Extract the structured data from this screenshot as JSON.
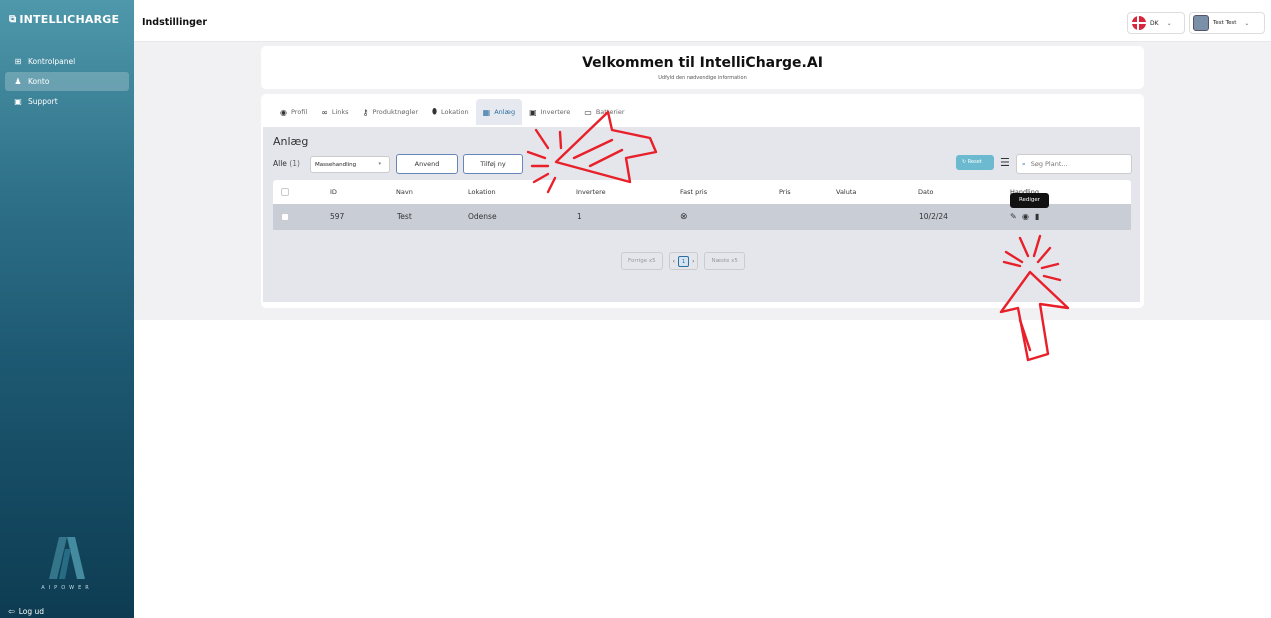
{
  "sidebar": {
    "brand": "INTELLICHARGE",
    "items": [
      {
        "label": "Kontrolpanel",
        "icon": "grid-icon"
      },
      {
        "label": "Konto",
        "icon": "users-icon"
      },
      {
        "label": "Support",
        "icon": "support-icon"
      }
    ],
    "active_index": 1,
    "logo_text": "AIPOWER",
    "logout": "Log ud"
  },
  "header": {
    "title": "Indstillinger",
    "language": "DK",
    "user": "Test Test"
  },
  "welcome": {
    "title": "Velkommen til IntelliCharge.AI",
    "subtitle": "Udfyld den nødvendige information"
  },
  "tabs": [
    {
      "label": "Profil",
      "icon": "user-circle-icon"
    },
    {
      "label": "Links",
      "icon": "link-icon"
    },
    {
      "label": "Produktnøgler",
      "icon": "key-icon"
    },
    {
      "label": "Lokation",
      "icon": "location-pin-icon"
    },
    {
      "label": "Anlæg",
      "icon": "dashboard-icon"
    },
    {
      "label": "Invertere",
      "icon": "chip-icon"
    },
    {
      "label": "Batterier",
      "icon": "battery-icon"
    }
  ],
  "active_tab": "Anlæg",
  "panel": {
    "title": "Anlæg",
    "alle_label": "Alle",
    "alle_count": "(1)",
    "bulk_select": "Massehandling",
    "apply_button": "Anvend",
    "add_button": "Tilføj ny",
    "reset_button": "Reset",
    "search_placeholder": "Søg Plant..."
  },
  "table": {
    "columns": [
      "ID",
      "Navn",
      "Lokation",
      "Invertere",
      "Fast pris",
      "Pris",
      "Valuta",
      "Dato",
      "Handling"
    ],
    "rows": [
      {
        "id": "597",
        "navn": "Test",
        "lokation": "Odense",
        "invertere": "1",
        "fast_pris": "⊗",
        "pris": "",
        "valuta": "",
        "dato": "10/2/24"
      }
    ],
    "tooltip": "Rediger"
  },
  "pagination": {
    "prev": "Forrige x5",
    "current": "1",
    "next": "Næste x5"
  },
  "colors": {
    "accent": "#2d6fa0",
    "reset": "#6cbad0",
    "annotation": "#e8202a"
  }
}
